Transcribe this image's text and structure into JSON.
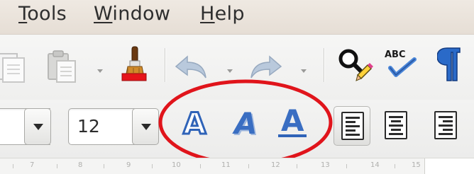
{
  "menubar": {
    "items": [
      {
        "label": "Tools",
        "mnemonic": "T",
        "rest": "ools"
      },
      {
        "label": "Window",
        "mnemonic": "W",
        "rest": "indow"
      },
      {
        "label": "Help",
        "mnemonic": "H",
        "rest": "elp"
      }
    ]
  },
  "toolbar": {
    "icons": [
      "copy-icon",
      "paste-icon",
      "clone-formatting-icon",
      "undo-icon",
      "redo-icon",
      "find-replace-icon",
      "spellcheck-icon",
      "formatting-marks-icon"
    ],
    "spellcheck_text": "ABC"
  },
  "formatting": {
    "font_size": "12",
    "font_effects": [
      "Outline",
      "Shadow",
      "Underline"
    ],
    "font_effect_glyph": "A",
    "align": [
      "align-left",
      "align-center",
      "align-right"
    ],
    "annotation_color": "#e0141b",
    "accent_color": "#2f63b8"
  },
  "ruler": {
    "labels": [
      "7",
      "8",
      "9",
      "10",
      "11",
      "12",
      "13",
      "14",
      "15"
    ]
  }
}
